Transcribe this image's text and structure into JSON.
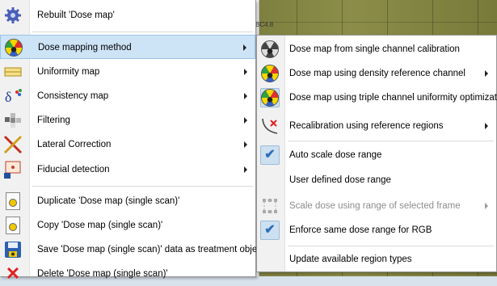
{
  "background": {
    "label": "BC4.8"
  },
  "main_menu": {
    "items": [
      {
        "label": "Rebuilt 'Dose map'",
        "icon": "gear-icon"
      },
      {
        "label": "Dose mapping method",
        "icon": "radiation-icon"
      },
      {
        "label": "Uniformity map",
        "icon": "uniformity-icon"
      },
      {
        "label": "Consistency map",
        "icon": "delta-icon"
      },
      {
        "label": "Filtering",
        "icon": "filter-icon"
      },
      {
        "label": "Lateral Correction",
        "icon": "lateral-correction-icon"
      },
      {
        "label": "Fiducial detection",
        "icon": "fiducial-icon"
      },
      {
        "label": "Duplicate 'Dose map (single scan)'",
        "icon": "duplicate-doc-icon"
      },
      {
        "label": "Copy 'Dose map (single scan)'",
        "icon": "copy-doc-icon"
      },
      {
        "label": "Save 'Dose map (single scan)' data as treatment object ...",
        "icon": "save-icon"
      },
      {
        "label": "Delete 'Dose map (single scan)'",
        "icon": "delete-icon"
      }
    ]
  },
  "sub_menu": {
    "items": [
      {
        "label": "Dose map from single channel calibration",
        "icon": "radiation-gray-icon"
      },
      {
        "label": "Dose map using density reference channel",
        "icon": "radiation-icon"
      },
      {
        "label": "Dose map using triple channel uniformity optimization",
        "icon": "radiation-icon"
      },
      {
        "label": "Recalibration using reference regions",
        "icon": "curve-x-icon"
      },
      {
        "label": "Auto scale dose range",
        "icon": "check-icon"
      },
      {
        "label": "User defined dose range",
        "icon": ""
      },
      {
        "label": "Scale dose using range of selected frame",
        "icon": "frame-icon"
      },
      {
        "label": "Enforce same dose range for RGB",
        "icon": "check-icon"
      },
      {
        "label": "Update available region types",
        "icon": ""
      }
    ]
  },
  "colors": {
    "highlight": "#cde3f6",
    "highlight_border": "#9ac4ea",
    "disabled_text": "#8d8d8d"
  }
}
